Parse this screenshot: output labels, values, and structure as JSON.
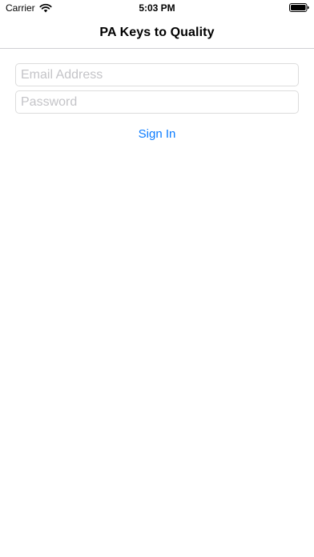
{
  "status_bar": {
    "carrier": "Carrier",
    "time": "5:03 PM",
    "icons": [
      "wifi-icon",
      "battery-icon"
    ]
  },
  "nav": {
    "title": "PA Keys to Quality"
  },
  "form": {
    "email": {
      "value": "",
      "placeholder": "Email Address"
    },
    "password": {
      "value": "",
      "placeholder": "Password"
    },
    "sign_in_label": "Sign In"
  },
  "colors": {
    "accent": "#0a7bff",
    "placeholder": "#c4c4c8",
    "field_border": "#dcdcdc",
    "divider": "#d0d0d4"
  }
}
